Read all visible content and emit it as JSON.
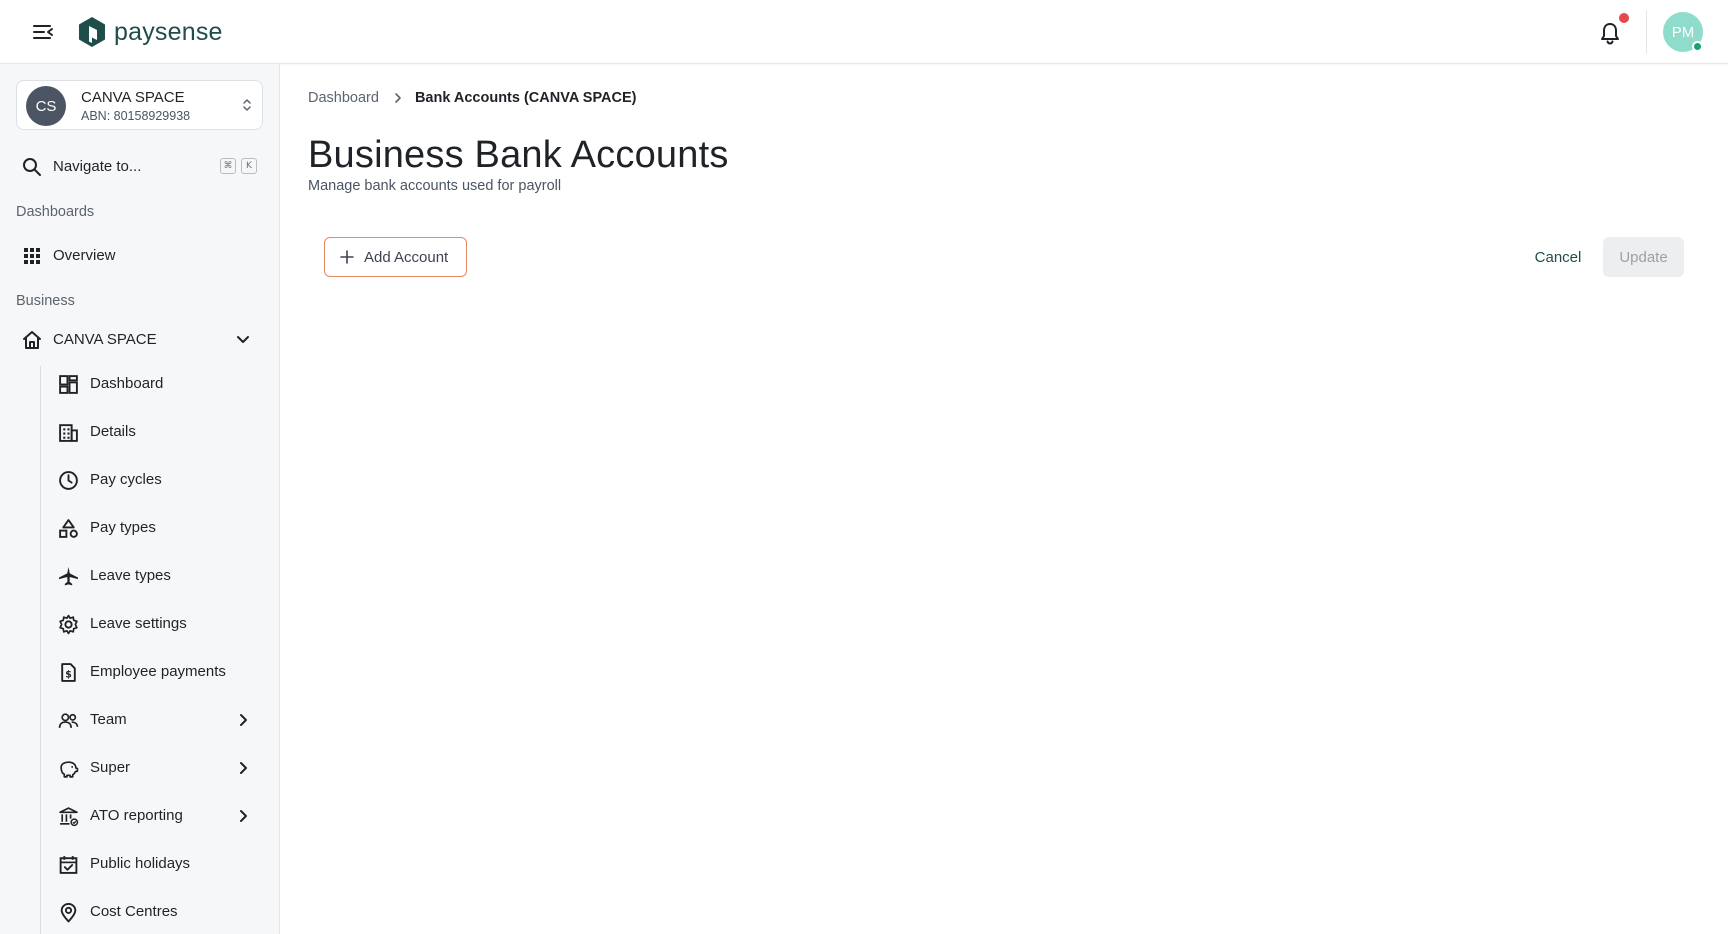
{
  "brand": {
    "name": "paysense",
    "color": "#1f4d4a"
  },
  "header": {
    "user_initials": "PM",
    "notification_indicator": true
  },
  "org": {
    "initials": "CS",
    "name": "CANVA SPACE",
    "abn": "ABN: 80158929938"
  },
  "nav_search": {
    "label": "Navigate to...",
    "shortcut": [
      "⌘",
      "K"
    ]
  },
  "sidebar": {
    "sections": {
      "dashboards": "Dashboards",
      "business": "Business"
    },
    "overview_label": "Overview",
    "business_name": "CANVA SPACE",
    "sub_items": [
      {
        "label": "Dashboard",
        "icon": "dashboard-icon"
      },
      {
        "label": "Details",
        "icon": "building-icon"
      },
      {
        "label": "Pay cycles",
        "icon": "clock-icon"
      },
      {
        "label": "Pay types",
        "icon": "shapes-icon"
      },
      {
        "label": "Leave types",
        "icon": "plane-icon"
      },
      {
        "label": "Leave settings",
        "icon": "gear-icon"
      },
      {
        "label": "Employee payments",
        "icon": "payment-document-icon"
      },
      {
        "label": "Team",
        "icon": "team-icon",
        "expandable": true
      },
      {
        "label": "Super",
        "icon": "piggy-bank-icon",
        "expandable": true
      },
      {
        "label": "ATO reporting",
        "icon": "bank-icon",
        "expandable": true
      },
      {
        "label": "Public holidays",
        "icon": "calendar-check-icon"
      },
      {
        "label": "Cost Centres",
        "icon": "location-pin-icon"
      }
    ]
  },
  "breadcrumb": {
    "root": "Dashboard",
    "current": "Bank Accounts (CANVA SPACE)"
  },
  "page": {
    "title": "Business Bank Accounts",
    "subtitle": "Manage bank accounts used for payroll"
  },
  "actions": {
    "add_account": "Add Account",
    "cancel": "Cancel",
    "update": "Update"
  },
  "colors": {
    "accent_border": "#e48a64",
    "notification": "#e5484d",
    "avatar": "#8fdccd",
    "online": "#17a36b"
  }
}
